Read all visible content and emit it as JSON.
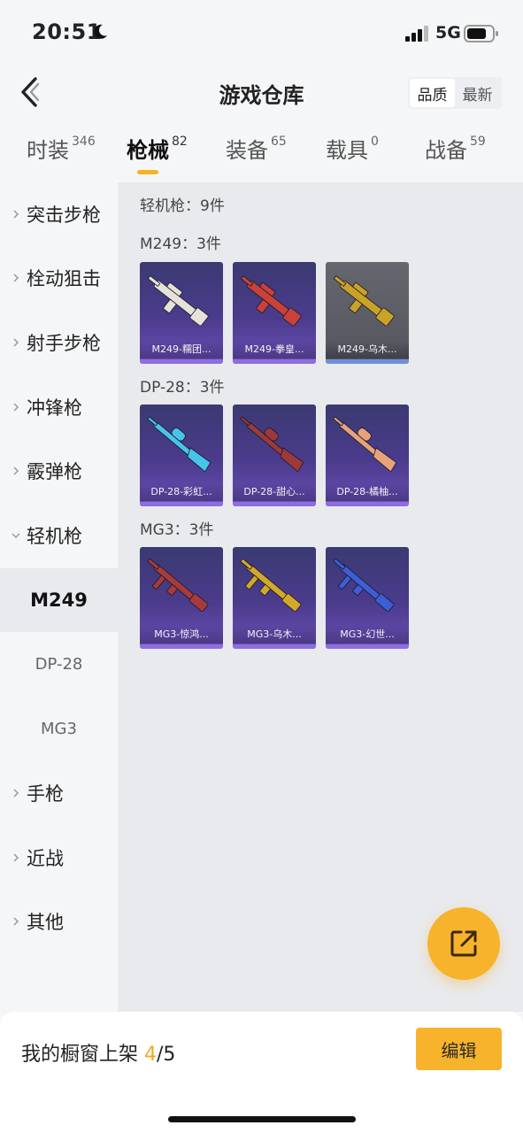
{
  "status_bar": {
    "time": "20:51",
    "network": "5G",
    "icons": [
      "moon-icon",
      "signal-icon",
      "battery-icon"
    ]
  },
  "header": {
    "title": "游戏仓库",
    "back_icon": "chevron-left-icon",
    "sort_options": [
      {
        "label": "品质",
        "active": true
      },
      {
        "label": "最新",
        "active": false
      }
    ]
  },
  "tabs": [
    {
      "label": "时装",
      "count": "346",
      "active": false
    },
    {
      "label": "枪械",
      "count": "82",
      "active": true
    },
    {
      "label": "装备",
      "count": "65",
      "active": false
    },
    {
      "label": "载具",
      "count": "0",
      "active": false
    },
    {
      "label": "战备",
      "count": "59",
      "active": false
    }
  ],
  "sidebar": {
    "categories": [
      {
        "label": "突击步枪",
        "expanded": false
      },
      {
        "label": "栓动狙击",
        "expanded": false
      },
      {
        "label": "射手步枪",
        "expanded": false
      },
      {
        "label": "冲锋枪",
        "expanded": false
      },
      {
        "label": "霰弹枪",
        "expanded": false
      },
      {
        "label": "轻机枪",
        "expanded": true
      },
      {
        "label": "手枪",
        "expanded": false
      },
      {
        "label": "近战",
        "expanded": false
      },
      {
        "label": "其他",
        "expanded": false
      }
    ],
    "subitems": [
      {
        "label": "M249",
        "active": true
      },
      {
        "label": "DP-28",
        "active": false
      },
      {
        "label": "MG3",
        "active": false
      }
    ]
  },
  "content": {
    "summary": "轻机枪：9件",
    "sections": [
      {
        "title": "M249：3件",
        "items": [
          {
            "name": "M249-糯团...",
            "theme": "purple",
            "gun_color": "#e6e2da"
          },
          {
            "name": "M249-拳皇...",
            "theme": "purple",
            "gun_color": "#c8423a"
          },
          {
            "name": "M249-乌木...",
            "theme": "gray",
            "gun_color": "#c9a227"
          }
        ]
      },
      {
        "title": "DP-28：3件",
        "items": [
          {
            "name": "DP-28-彩虹...",
            "theme": "purple",
            "gun_color": "#48c4e8"
          },
          {
            "name": "DP-28-甜心...",
            "theme": "purple",
            "gun_color": "#9c3a3a"
          },
          {
            "name": "DP-28-橘柚...",
            "theme": "purple",
            "gun_color": "#e8a27a"
          }
        ]
      },
      {
        "title": "MG3：3件",
        "items": [
          {
            "name": "MG3-惊鸿...",
            "theme": "purple",
            "gun_color": "#a83a3a"
          },
          {
            "name": "MG3-乌木...",
            "theme": "purple",
            "gun_color": "#d2a82b"
          },
          {
            "name": "MG3-幻世...",
            "theme": "purple",
            "gun_color": "#3c5ed6"
          }
        ]
      }
    ]
  },
  "fab": {
    "icon": "share-external-icon"
  },
  "bottom_bar": {
    "shelf_prefix": "我的橱窗上架",
    "shelf_current": "4",
    "shelf_total": "/5",
    "edit_label": "编辑"
  },
  "colors": {
    "accent": "#f7b32b",
    "card_purple": "#4b3b8c",
    "card_gray": "#5a5b62"
  }
}
